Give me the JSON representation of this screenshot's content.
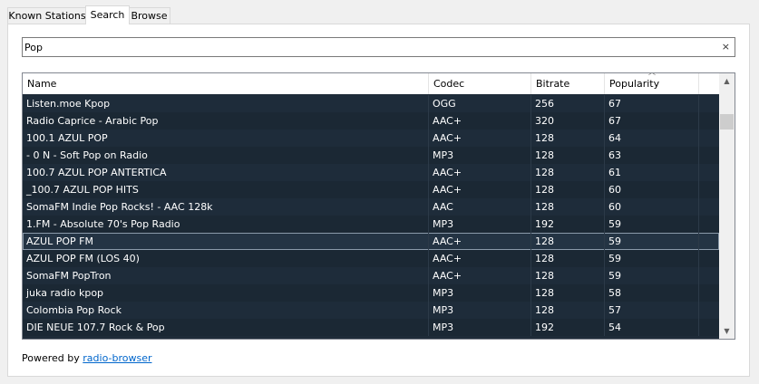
{
  "tabs": [
    "Known Stations",
    "Search",
    "Browse"
  ],
  "search": {
    "value": "Pop",
    "clear_icon": "×"
  },
  "table": {
    "columns": [
      "Name",
      "Codec",
      "Bitrate",
      "Popularity"
    ],
    "sort_column": "Popularity",
    "rows": [
      [
        "Listen.moe Kpop",
        "OGG",
        "256",
        "67"
      ],
      [
        "Radio Caprice - Arabic Pop",
        "AAC+",
        "320",
        "67"
      ],
      [
        "100.1 AZUL POP",
        "AAC+",
        "128",
        "64"
      ],
      [
        "- 0 N - Soft Pop on Radio",
        "MP3",
        "128",
        "63"
      ],
      [
        "100.7 AZUL POP ANTERTICA",
        "AAC+",
        "128",
        "61"
      ],
      [
        "_100.7 AZUL POP HITS",
        "AAC+",
        "128",
        "60"
      ],
      [
        "SomaFM Indie Pop Rocks! - AAC 128k",
        "AAC",
        "128",
        "60"
      ],
      [
        "1.FM - Absolute 70's Pop Radio",
        "MP3",
        "192",
        "59"
      ],
      [
        "AZUL POP FM",
        "AAC+",
        "128",
        "59"
      ],
      [
        "AZUL POP FM (LOS 40)",
        "AAC+",
        "128",
        "59"
      ],
      [
        "SomaFM PopTron",
        "AAC+",
        "128",
        "59"
      ],
      [
        "juka radio kpop",
        "MP3",
        "128",
        "58"
      ],
      [
        "Colombia Pop Rock",
        "MP3",
        "128",
        "57"
      ],
      [
        "DIE NEUE 107.7 Rock & Pop",
        "MP3",
        "192",
        "54"
      ]
    ],
    "selected_index": 8
  },
  "footer": {
    "prefix": "Powered by ",
    "link": "radio-browser"
  },
  "colors": {
    "row_bg": "#1e2c3a",
    "row_text": "#ffffff",
    "link": "#0066cc"
  }
}
